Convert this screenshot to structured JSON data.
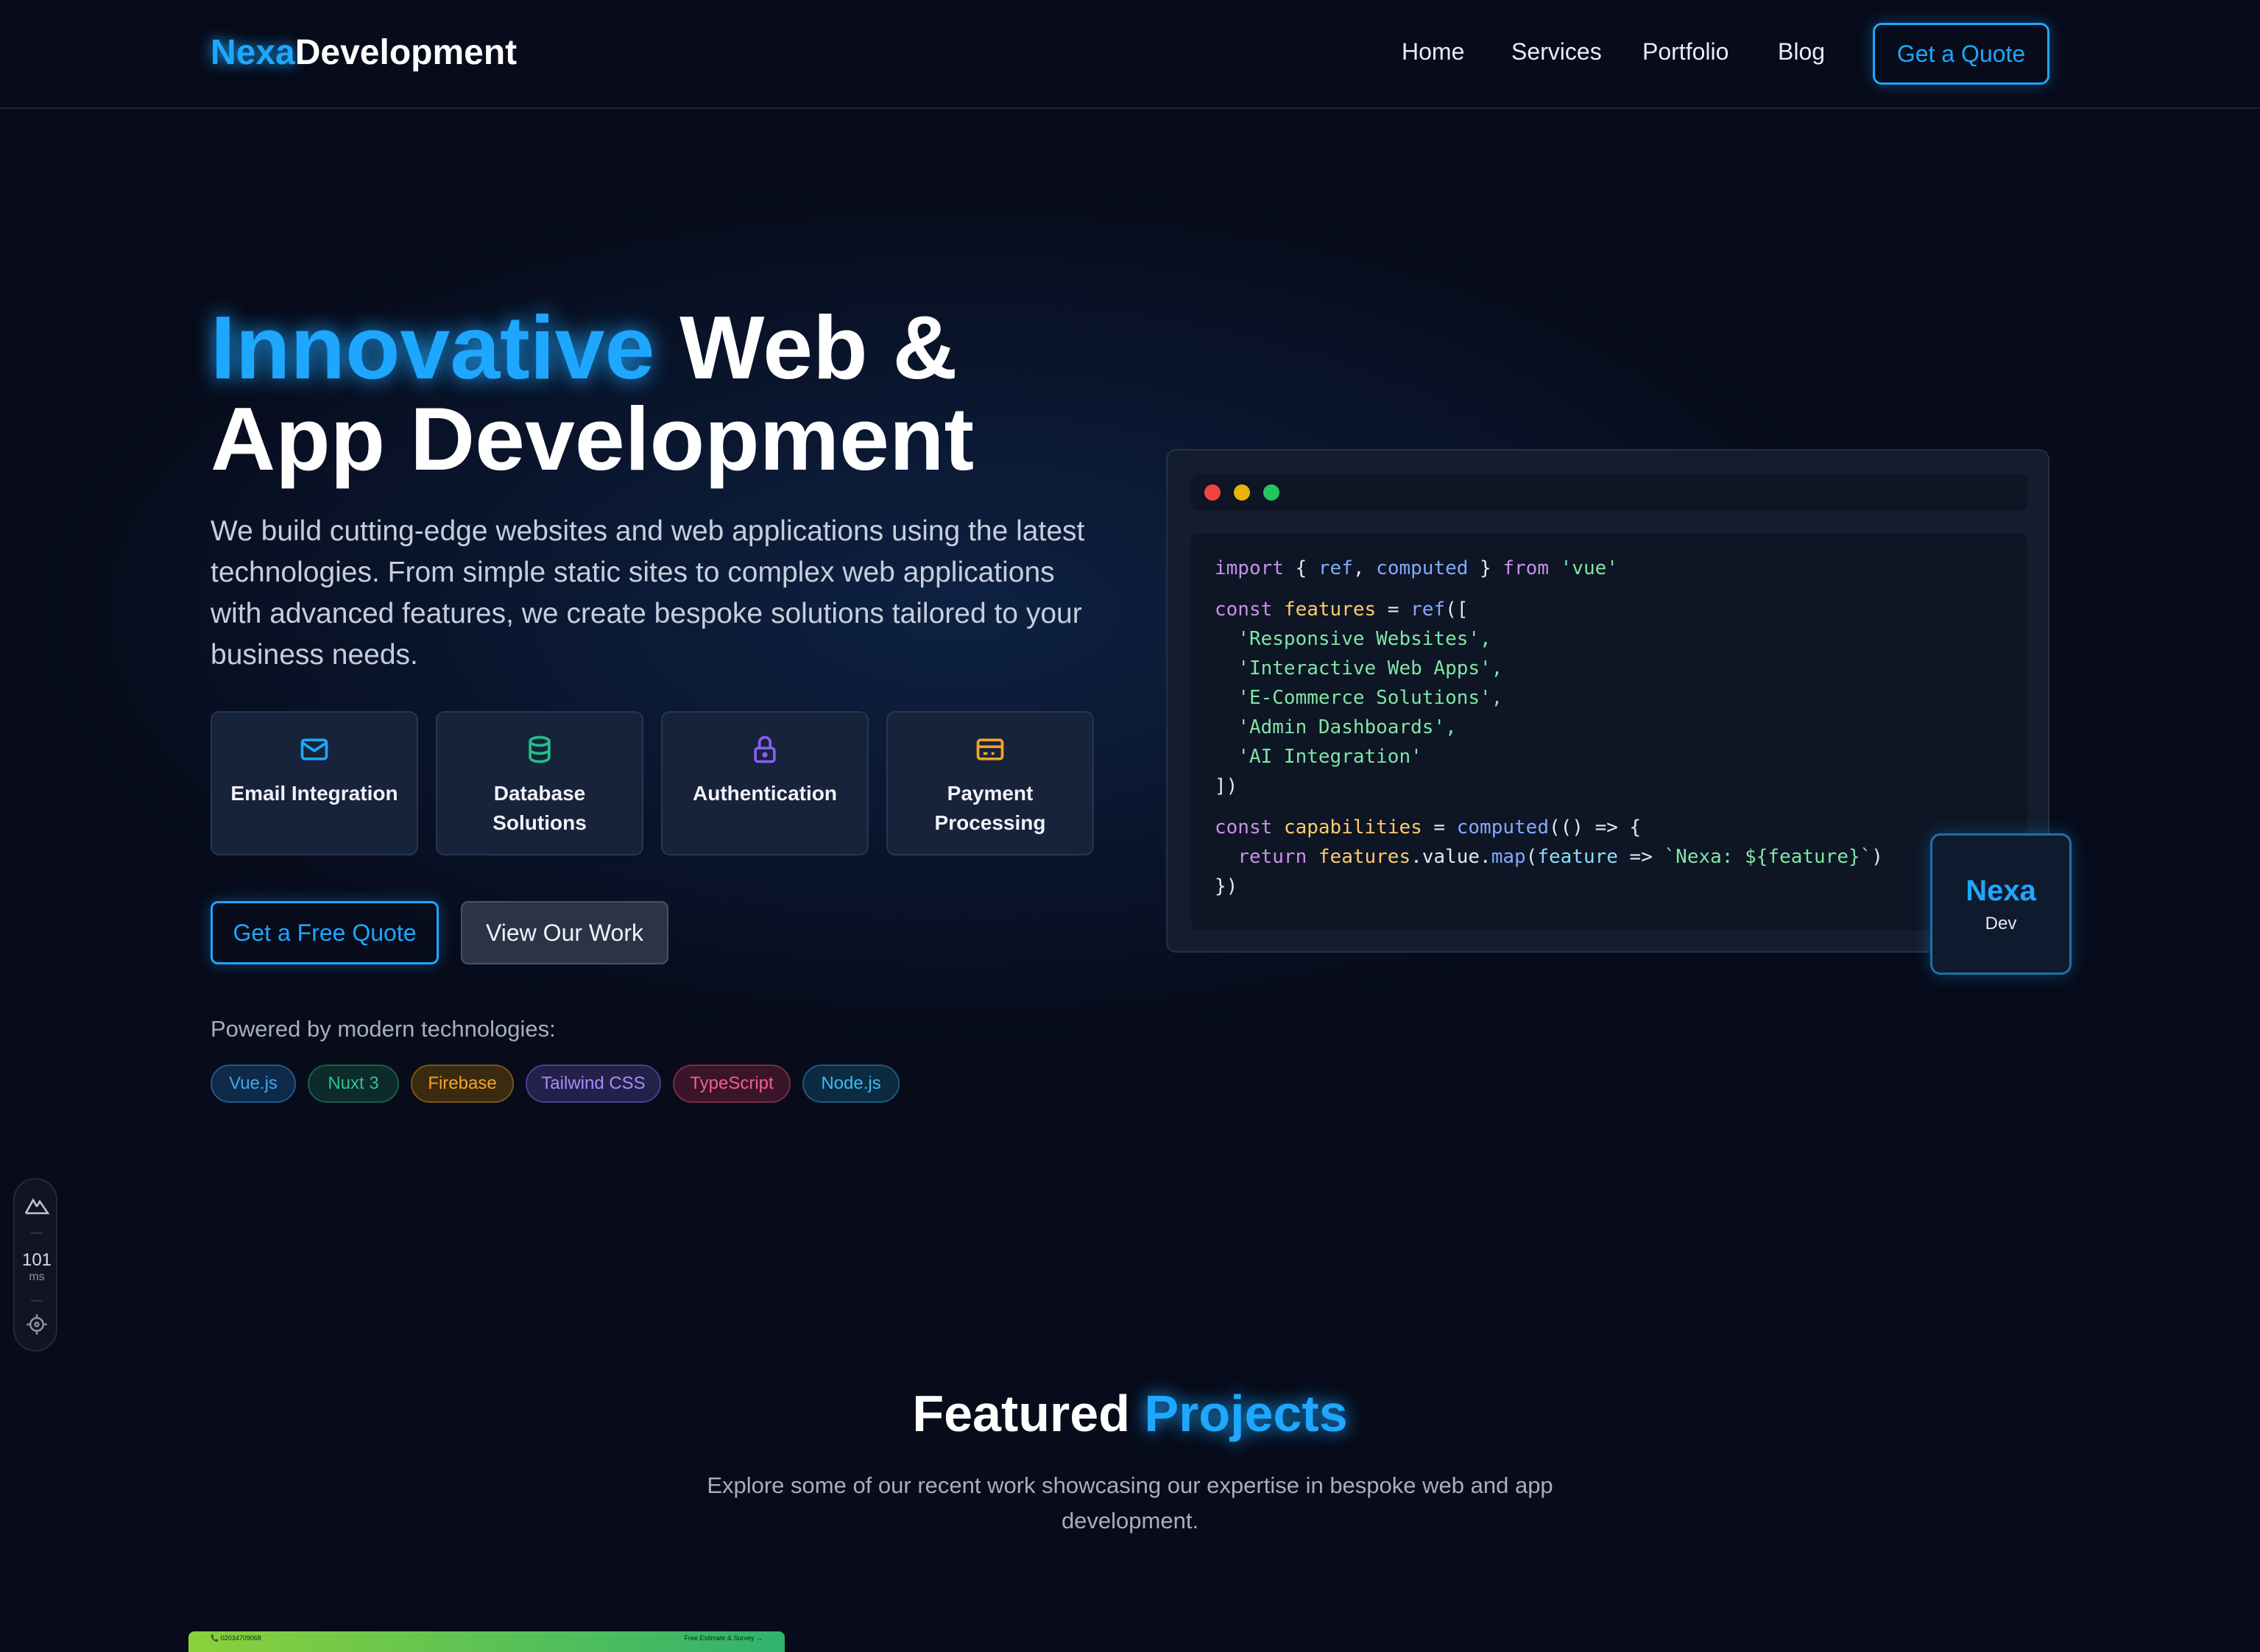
{
  "header": {
    "logo_part1": "Nexa",
    "logo_part2": "Development",
    "nav": [
      "Home",
      "Services",
      "Portfolio",
      "Blog"
    ],
    "cta": "Get a Quote"
  },
  "hero": {
    "title_highlight": "Innovative",
    "title_rest1": " Web &",
    "title_line2": "App Development",
    "description": "We build cutting-edge websites and web applications using the latest technologies. From simple static sites to complex web applications with advanced features, we create bespoke solutions tailored to your business needs.",
    "features": [
      {
        "label": "Email Integration",
        "icon": "mail-icon",
        "color": "#1ea7ff"
      },
      {
        "label": "Database Solutions",
        "icon": "database-icon",
        "color": "#22c08a"
      },
      {
        "label": "Authentication",
        "icon": "lock-icon",
        "color": "#8b5cf6"
      },
      {
        "label": "Payment Processing",
        "icon": "credit-card-icon",
        "color": "#f5a524"
      }
    ],
    "primary_button": "Get a Free Quote",
    "secondary_button": "View Our Work",
    "powered_label": "Powered by modern technologies:",
    "technologies": [
      {
        "label": "Vue.js",
        "color": "#3ba8f5",
        "bg": "#0f2a48",
        "border": "#1d5a8e"
      },
      {
        "label": "Nuxt 3",
        "color": "#2fc28d",
        "bg": "#0c2b2a",
        "border": "#1a5e4c"
      },
      {
        "label": "Firebase",
        "color": "#f5a524",
        "bg": "#3a2a10",
        "border": "#7a5418"
      },
      {
        "label": "Tailwind CSS",
        "color": "#a78bfa",
        "bg": "#23204a",
        "border": "#4a3f8e"
      },
      {
        "label": "TypeScript",
        "color": "#f0608a",
        "bg": "#3a1428",
        "border": "#7a2a4a"
      },
      {
        "label": "Node.js",
        "color": "#38bdf8",
        "bg": "#0c2a40",
        "border": "#1a5a7e"
      }
    ]
  },
  "code": {
    "window_dots": [
      "#ef4444",
      "#eab308",
      "#22c55e"
    ],
    "line_import": [
      "import",
      " { ",
      "ref",
      ", ",
      "computed",
      " } ",
      "from",
      " ",
      "'vue'"
    ],
    "line_const1": [
      "const",
      " ",
      "features",
      " = ",
      "ref",
      "(["
    ],
    "items": [
      "'Responsive Websites',",
      "'Interactive Web Apps',",
      "'E-Commerce Solutions',",
      "'Admin Dashboards',",
      "'AI Integration'"
    ],
    "close1": "])",
    "line_const2": [
      "const",
      " ",
      "capabilities",
      " = ",
      "computed",
      "(() => {"
    ],
    "line_return": [
      "return",
      " ",
      "features",
      ".value.",
      "map",
      "(",
      "feature",
      " => ",
      "`Nexa: ${feature}`",
      ")"
    ],
    "close2": "})"
  },
  "badge": {
    "name": "Nexa",
    "sub": "Dev"
  },
  "devtools": {
    "value": "101",
    "unit": "ms"
  },
  "featured": {
    "title_part1": "Featured ",
    "title_part2": "Projects",
    "subtitle": "Explore some of our recent work showcasing our expertise in bespoke web and app development."
  },
  "preview": {
    "left_text": "📞 02034709068",
    "right_text": "Free Estimate & Survey →"
  }
}
